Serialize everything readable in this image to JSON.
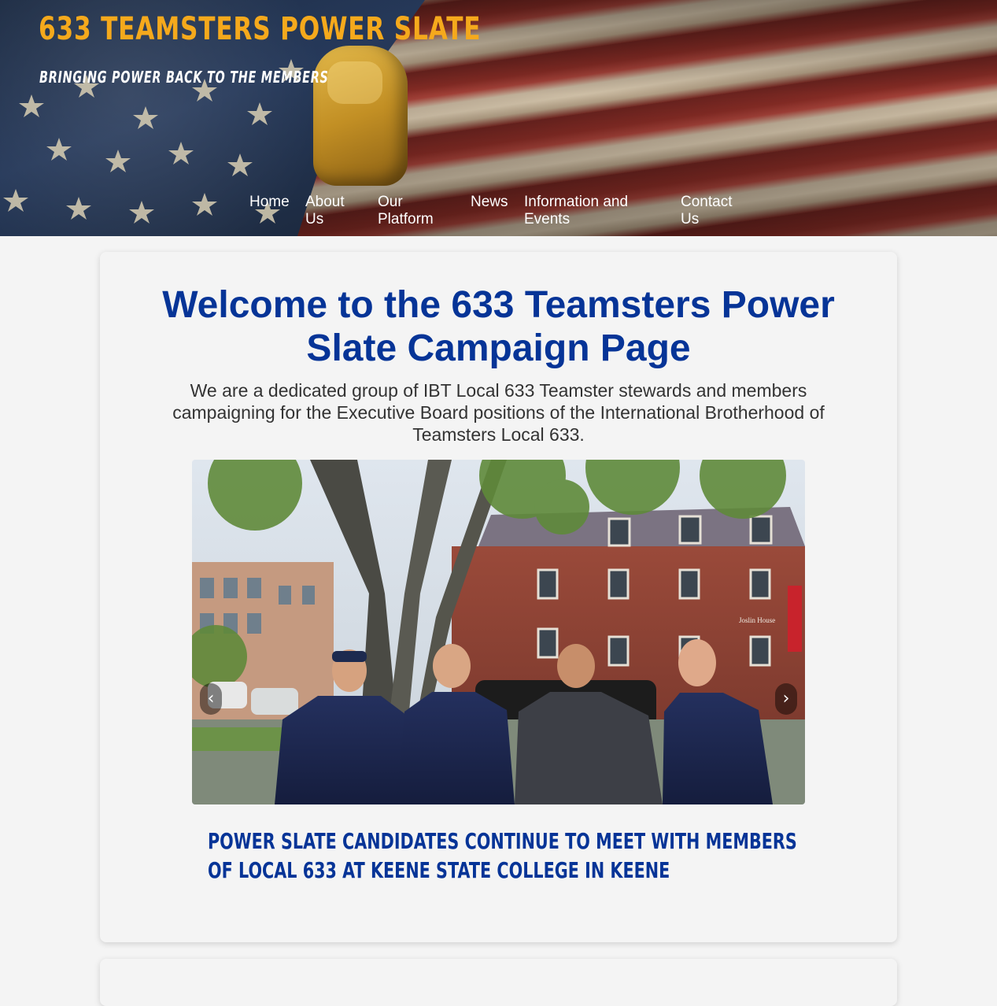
{
  "header": {
    "site_title": "633 TEAMSTERS POWER SLATE",
    "tagline": "BRINGING POWER BACK TO THE MEMBERS"
  },
  "nav": {
    "items": [
      {
        "label": "Home"
      },
      {
        "label": "About Us"
      },
      {
        "label": "Our Platform"
      },
      {
        "label": "News"
      },
      {
        "label": "Information and Events"
      },
      {
        "label": "Contact Us"
      }
    ]
  },
  "main": {
    "title": "Welcome to the 633 Teamsters Power Slate Campaign Page",
    "intro": "We are a dedicated group of IBT Local 633 Teamster stewards and members campaigning for the Executive Board positions of the International Brotherhood of Teamsters Local 633.",
    "carousel": {
      "prev_glyph": "‹",
      "next_glyph": "›",
      "slide_sign_text": "Joslin House",
      "caption": "Power Slate candidates continue to meet with members of Local 633 at Keene State College in Keene"
    }
  },
  "colors": {
    "title_blue": "#063497",
    "site_title_gold": "#f5a91c",
    "page_bg": "#f4f4f4"
  }
}
